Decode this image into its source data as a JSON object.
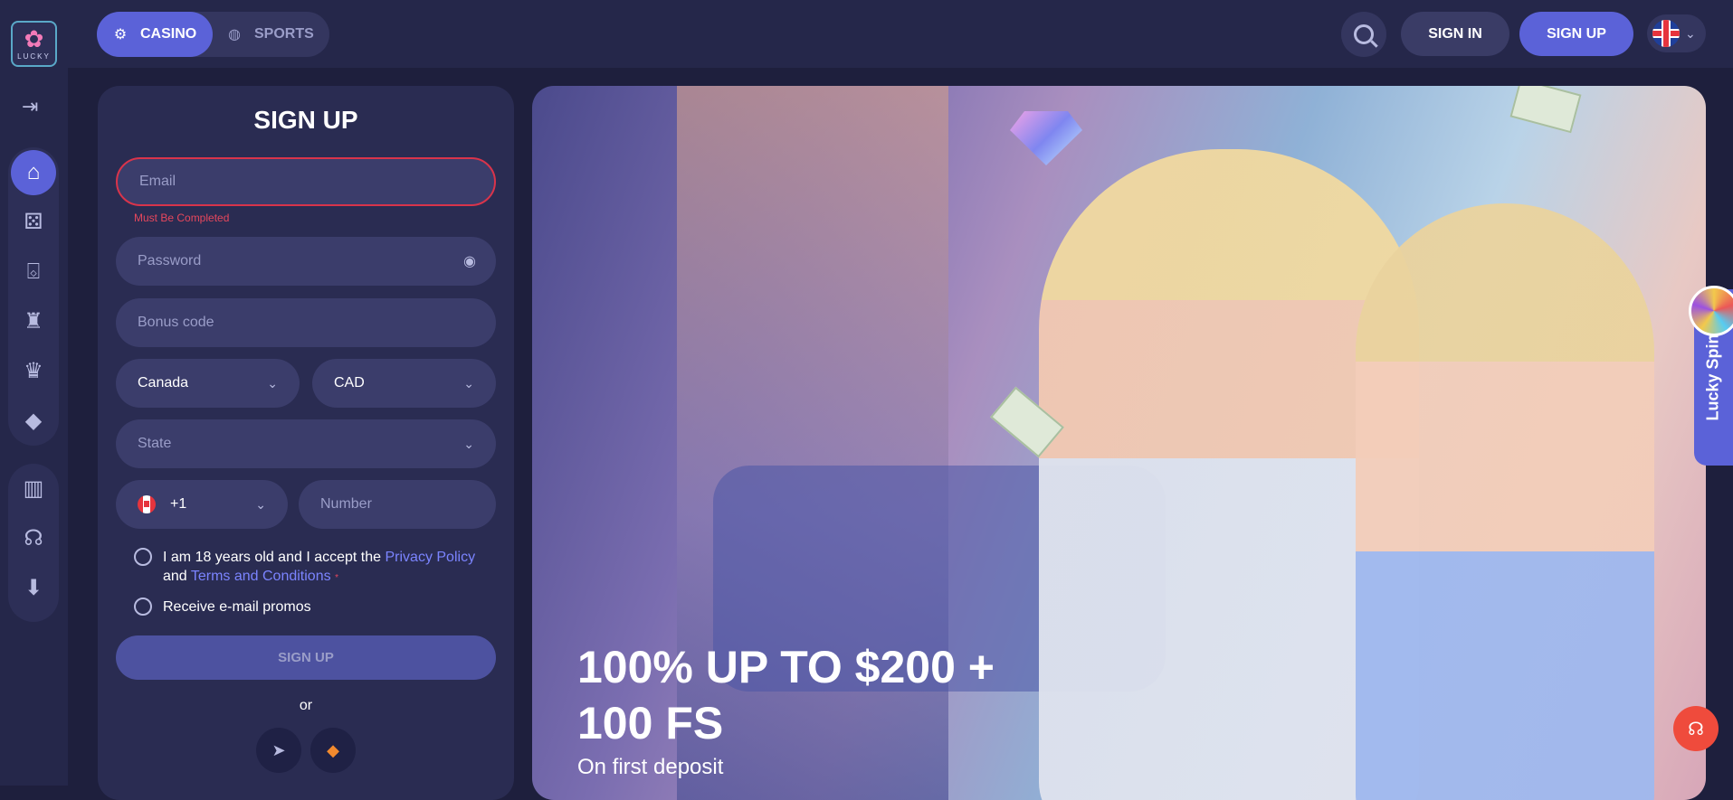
{
  "header": {
    "logo_text": "LUCKY",
    "modes": {
      "casino": "CASINO",
      "sports": "SPORTS"
    },
    "signin": "SIGN IN",
    "signup": "SIGN UP"
  },
  "form": {
    "title": "SIGN UP",
    "email_placeholder": "Email",
    "email_error": "Must Be Completed",
    "password_placeholder": "Password",
    "bonus_placeholder": "Bonus code",
    "country": "Canada",
    "currency": "CAD",
    "state_placeholder": "State",
    "phone_code": "+1",
    "number_placeholder": "Number",
    "accept_prefix": "I am 18 years old and I accept the",
    "privacy_link": "Privacy Policy",
    "and": "and",
    "terms_link": "Terms and Conditions",
    "required_mark": "*",
    "promos": "Receive e-mail promos",
    "submit": "SIGN UP",
    "or": "or"
  },
  "hero": {
    "headline_line1": "100% UP TO $200 +",
    "headline_line2": "100 FS",
    "sub": "On first deposit"
  },
  "lucky_spin": "Lucky Spin",
  "icons": {
    "mode_casino": "casino-chip-icon",
    "mode_sports": "basketball-icon",
    "sidebar": [
      "collapse-icon",
      "home-icon",
      "dice-icon",
      "gift-icon",
      "trophy-icon",
      "crown-icon",
      "diamond-icon",
      "book-icon",
      "headphones-icon",
      "download-icon"
    ]
  },
  "colors": {
    "accent": "#5b62d8",
    "error": "#d9344b",
    "support": "#ef4b3c"
  }
}
